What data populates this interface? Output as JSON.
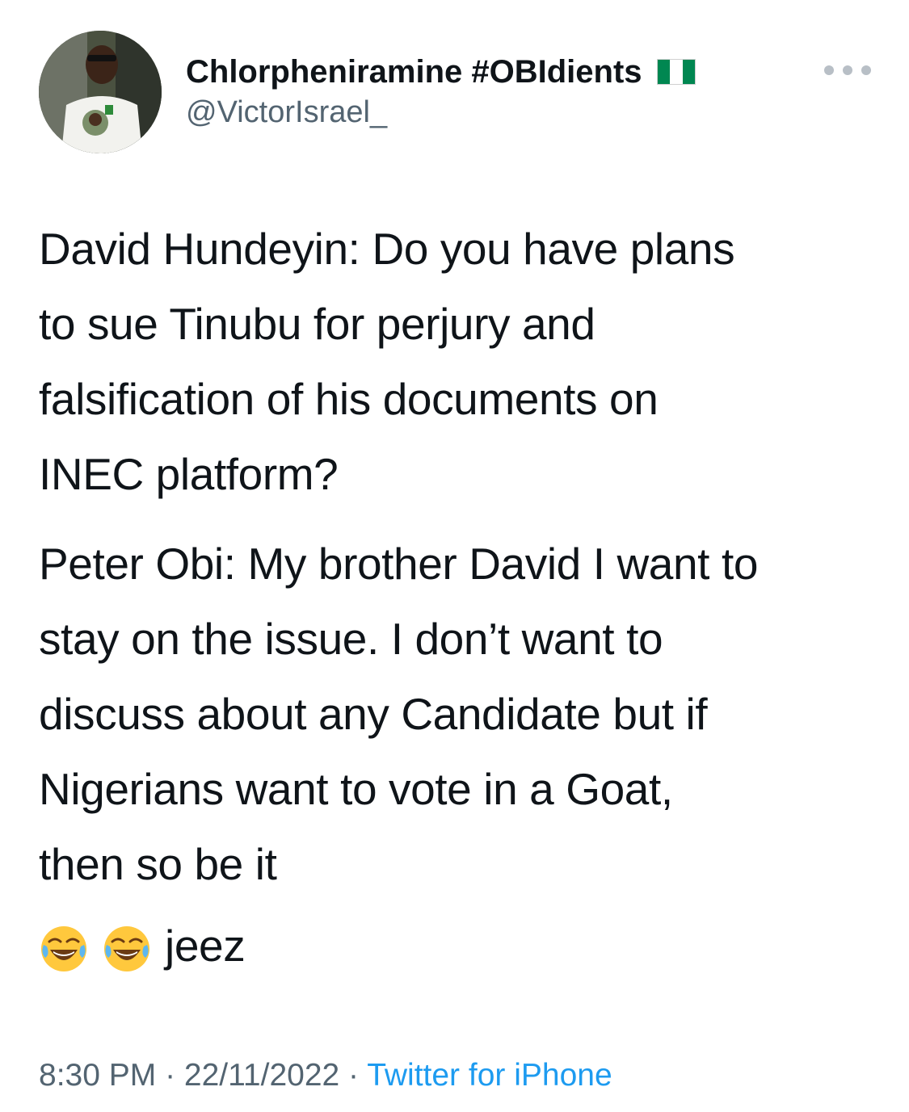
{
  "author": {
    "display_name": "Chlorpheniramine #OBIdients",
    "handle": "@VictorIsrael_",
    "flag_icon": "nigeria-flag-icon",
    "flag_colors": [
      "#008751",
      "#ffffff",
      "#008751"
    ]
  },
  "more_icon": "more-horizontal-icon",
  "tweet": {
    "paragraph_1": [
      "David Hundeyin: Do you have plans",
      "to sue Tinubu for perjury and",
      "falsification of his documents on",
      "INEC platform?"
    ],
    "paragraph_2": [
      "Peter Obi: My brother David I want to",
      "stay on the issue. I don’t want to",
      "discuss about any Candidate but if",
      "Nigerians want to vote in a Goat,",
      "then so be it"
    ],
    "emoji_icon": "face-with-tears-of-joy-icon",
    "emoji_count": 2,
    "closing_text": "jeez"
  },
  "meta": {
    "time": "8:30 PM",
    "separator": " · ",
    "date": "22/11/2022",
    "source": "Twitter for iPhone"
  },
  "colors": {
    "text_primary": "#0f1419",
    "text_secondary": "#536471",
    "link": "#1d9bf0"
  }
}
